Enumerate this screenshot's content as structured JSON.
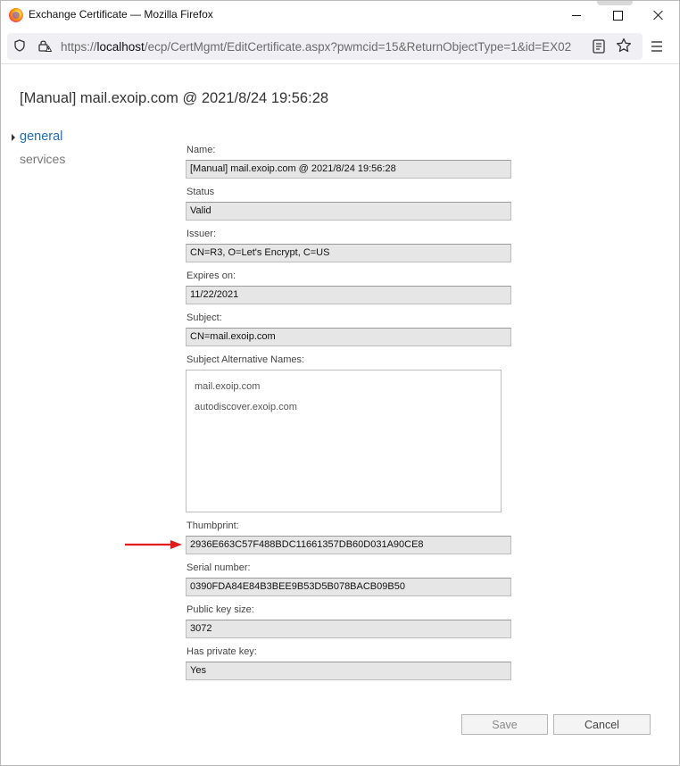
{
  "window": {
    "title": "Exchange Certificate — Mozilla Firefox"
  },
  "urlbar": {
    "url_prefix": "https://",
    "url_host": "localhost",
    "url_path": "/ecp/CertMgmt/EditCertificate.aspx?pwmcid=15&ReturnObjectType=1&id=EX02"
  },
  "page": {
    "title": "[Manual] mail.exoip.com @ 2021/8/24 19:56:28"
  },
  "nav": {
    "items": [
      {
        "label": "general",
        "selected": true
      },
      {
        "label": "services",
        "selected": false
      }
    ]
  },
  "fields": {
    "name": {
      "label": "Name:",
      "value": "[Manual] mail.exoip.com @ 2021/8/24 19:56:28"
    },
    "status": {
      "label": "Status",
      "value": "Valid"
    },
    "issuer": {
      "label": "Issuer:",
      "value": "CN=R3, O=Let's Encrypt, C=US"
    },
    "expires": {
      "label": "Expires on:",
      "value": "11/22/2021"
    },
    "subject": {
      "label": "Subject:",
      "value": "CN=mail.exoip.com"
    },
    "san": {
      "label": "Subject Alternative Names:",
      "values": [
        "mail.exoip.com",
        "autodiscover.exoip.com"
      ]
    },
    "thumbprint": {
      "label": "Thumbprint:",
      "value": "2936E663C57F488BDC11661357DB60D031A90CE8"
    },
    "serial": {
      "label": "Serial number:",
      "value": "0390FDA84E84B3BEE9B53D5B078BACB09B50"
    },
    "keysize": {
      "label": "Public key size:",
      "value": "3072"
    },
    "privatekey": {
      "label": "Has private key:",
      "value": "Yes"
    }
  },
  "buttons": {
    "save": "Save",
    "cancel": "Cancel"
  },
  "colors": {
    "accent": "#1e6bb8",
    "annotation_arrow": "#e31b1b"
  }
}
